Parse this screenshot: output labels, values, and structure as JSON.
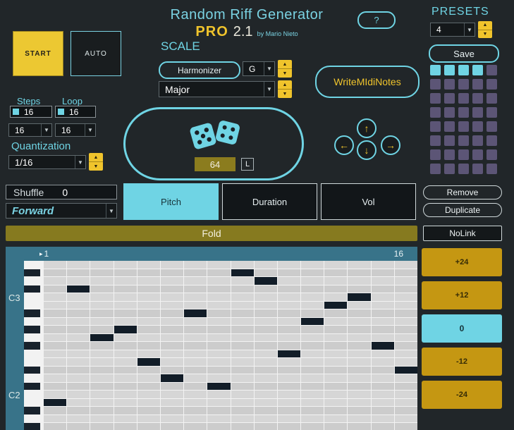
{
  "colors": {
    "accent_cyan": "#6fd4e4",
    "accent_yellow": "#f0c42c",
    "olive": "#867a1f",
    "gold": "#c59712",
    "purple": "#5c5576",
    "teal": "#387389",
    "note_color": "#121d28"
  },
  "header": {
    "title": "Random Riff Generator",
    "edition": "PRO",
    "version": "2.1",
    "byline": "by Mario Nieto",
    "help_label": "?"
  },
  "presets": {
    "label": "PRESETS",
    "selected_value": "4",
    "save_label": "Save",
    "grid": {
      "rows": 8,
      "cols": 5,
      "active_cells": [
        [
          0,
          0
        ],
        [
          0,
          1
        ],
        [
          0,
          2
        ],
        [
          0,
          3
        ]
      ]
    }
  },
  "transport": {
    "start_label": "START",
    "auto_label": "AUTO"
  },
  "scale": {
    "label": "SCALE",
    "harmonizer_label": "Harmonizer",
    "root_value": "G",
    "mode_value": "Major"
  },
  "write_midi": {
    "label": "WriteMIdiNotes"
  },
  "steps": {
    "label": "Steps",
    "value": "16",
    "division_value": "16"
  },
  "loop": {
    "label": "Loop",
    "value": "16",
    "division_value": "16"
  },
  "quantization": {
    "label": "Quantization",
    "value": "1/16"
  },
  "randomizer": {
    "value": "64",
    "latch_label": "L"
  },
  "nav_arrows": {
    "up": "↑",
    "down": "↓",
    "left": "←",
    "right": "→"
  },
  "playback": {
    "shuffle_label": "Shuffle",
    "shuffle_value": "0",
    "direction_value": "Forward"
  },
  "tabs": [
    {
      "label": "Pitch",
      "active": true
    },
    {
      "label": "Duration",
      "active": false
    },
    {
      "label": "Vol",
      "active": false
    }
  ],
  "preset_actions": {
    "remove_label": "Remove",
    "duplicate_label": "Duplicate"
  },
  "fold": {
    "label": "Fold"
  },
  "nolink": {
    "label": "NoLink"
  },
  "piano_roll": {
    "start_step_label": "1",
    "end_step_label": "16",
    "num_steps": 16,
    "num_rows": 21,
    "row_height": 11.5,
    "black_key_rows": [
      1,
      3,
      6,
      8,
      10,
      13,
      15,
      18,
      20
    ],
    "octave_labels": [
      {
        "text": "C3",
        "row": 4
      },
      {
        "text": "C2",
        "row": 16
      }
    ],
    "notes": [
      {
        "step": 1,
        "row": 17
      },
      {
        "step": 2,
        "row": 3
      },
      {
        "step": 3,
        "row": 9
      },
      {
        "step": 4,
        "row": 8
      },
      {
        "step": 5,
        "row": 12
      },
      {
        "step": 6,
        "row": 14
      },
      {
        "step": 7,
        "row": 6
      },
      {
        "step": 8,
        "row": 15
      },
      {
        "step": 9,
        "row": 1
      },
      {
        "step": 10,
        "row": 2
      },
      {
        "step": 11,
        "row": 11
      },
      {
        "step": 12,
        "row": 7
      },
      {
        "step": 13,
        "row": 5
      },
      {
        "step": 14,
        "row": 4
      },
      {
        "step": 15,
        "row": 10
      },
      {
        "step": 16,
        "row": 13
      }
    ]
  },
  "transpose_buttons": [
    {
      "label": "+24",
      "active": false
    },
    {
      "label": "+12",
      "active": false
    },
    {
      "label": "0",
      "active": true
    },
    {
      "label": "-12",
      "active": false
    },
    {
      "label": "-24",
      "active": false
    }
  ],
  "icons": {
    "dice": "two-dice",
    "spinner_up": "▲",
    "spinner_down": "▼",
    "dropdown_arrow": "▼",
    "loop_start_marker": "▸"
  }
}
